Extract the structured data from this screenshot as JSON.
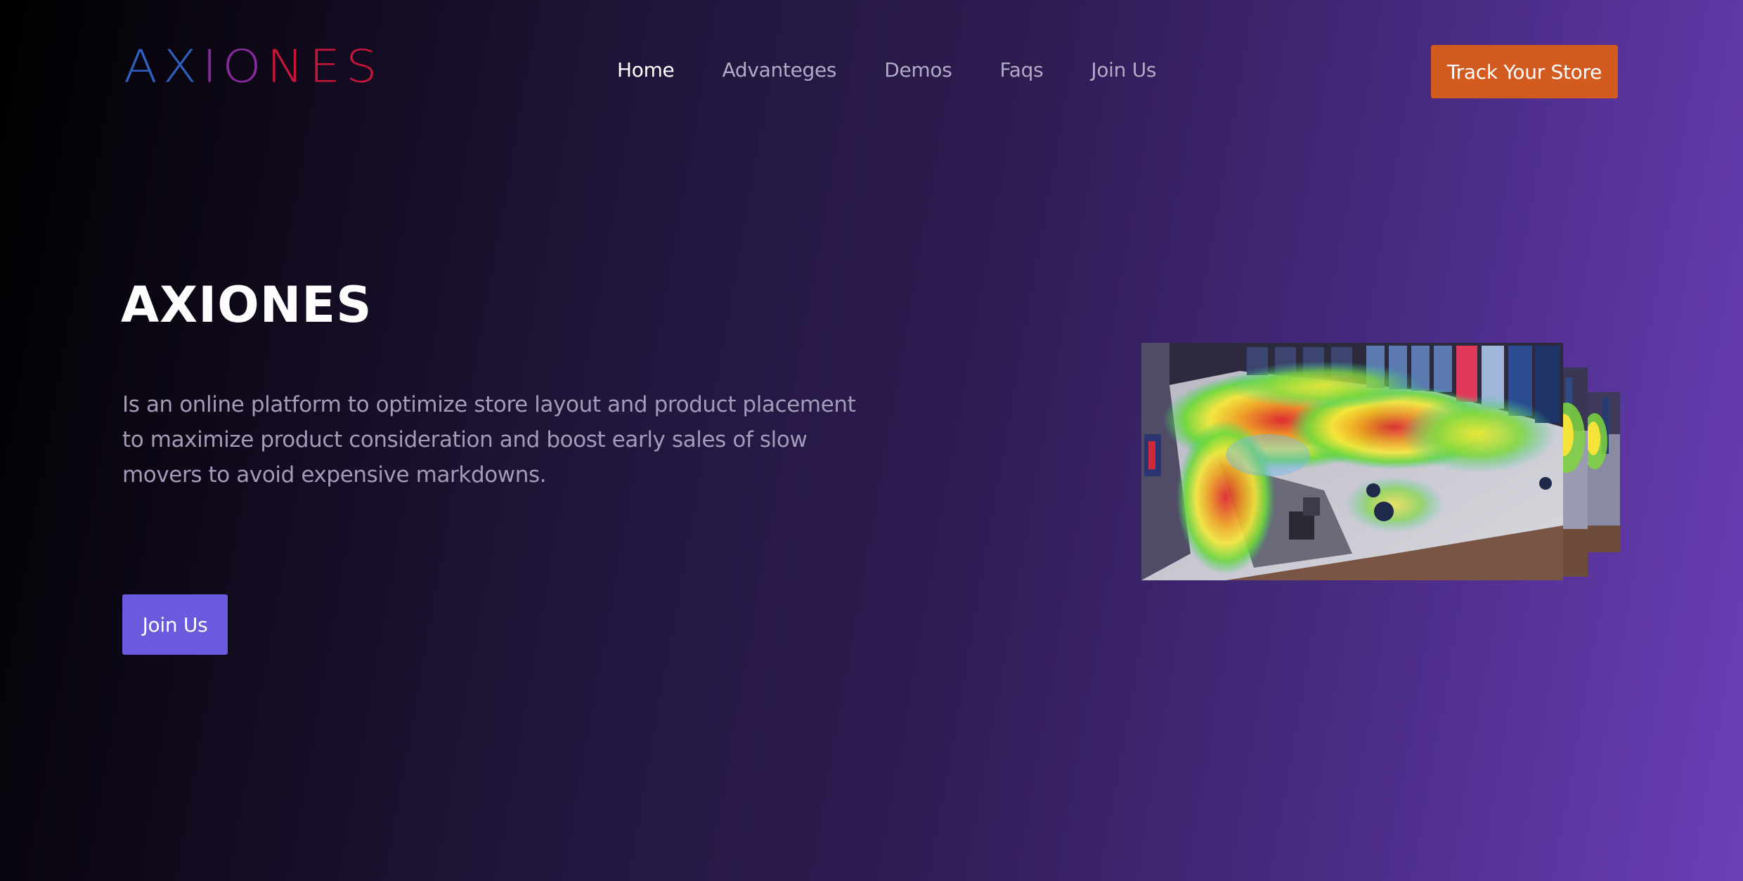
{
  "header": {
    "logo_parts": [
      "AX",
      "IO",
      "NES"
    ],
    "logo_colors": [
      "#2f5fbf",
      "#8a2aa0",
      "#c8163a"
    ],
    "nav": [
      {
        "label": "Home",
        "active": true
      },
      {
        "label": "Advanteges",
        "active": false
      },
      {
        "label": "Demos",
        "active": false
      },
      {
        "label": "Faqs",
        "active": false
      },
      {
        "label": "Join Us",
        "active": false
      }
    ],
    "cta_label": "Track Your Store"
  },
  "hero": {
    "title": "AXIONES",
    "description": "Is an online platform to optimize store layout and product placement to maximize product consideration and boost early sales of slow movers to avoid expensive markdowns.",
    "button_label": "Join Us"
  },
  "slider": {
    "image_subject": "store-heatmap",
    "visible_slides": 3
  },
  "colors": {
    "cta_bg": "#d35b1f",
    "join_bg": "#6a5bde",
    "text_muted": "#a49bb8",
    "nav_muted": "#b3aac6",
    "gradient_start": "#000000",
    "gradient_end": "#6a3fb8"
  }
}
